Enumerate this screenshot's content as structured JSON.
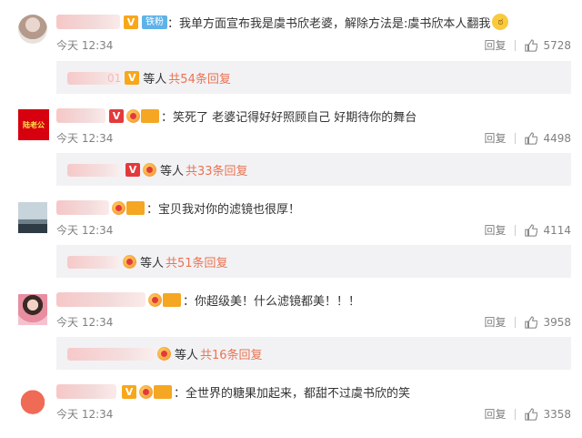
{
  "comments": [
    {
      "text": "：我单方面宣布我是虞书欣老婆，解除方法是:虞书欣本人翻我",
      "emoji": "ಠ",
      "time": "今天 12:34",
      "reply_label": "回复",
      "likes": "5728",
      "fan_label": "铁粉",
      "sub": {
        "name_fragment": "01",
        "dengren": "等人",
        "more": "共54条回复"
      }
    },
    {
      "avatar_text": "陆老公",
      "text": "：笑死了 老婆记得好好照顾自己 好期待你的舞台",
      "time": "今天 12:34",
      "reply_label": "回复",
      "likes": "4498",
      "sub": {
        "dengren": "等人",
        "more": "共33条回复"
      }
    },
    {
      "text": "：宝贝我对你的滤镜也很厚！",
      "time": "今天 12:34",
      "reply_label": "回复",
      "likes": "4114",
      "sub": {
        "dengren": "等人",
        "more": "共51条回复"
      }
    },
    {
      "text": "：你超级美！什么滤镜都美！！！",
      "time": "今天 12:34",
      "reply_label": "回复",
      "likes": "3958",
      "sub": {
        "dengren": "等人",
        "more": "共16条回复"
      }
    },
    {
      "text": "：全世界的糖果加起来，都甜不过虞书欣的笑",
      "time": "今天 12:34",
      "reply_label": "回复",
      "likes": "3358"
    }
  ],
  "badges": {
    "v": "V"
  },
  "colors": {
    "link": "#eb7350",
    "meta": "#808080",
    "subbox_bg": "#f2f2f5",
    "v_badge": "#f8a71a"
  }
}
